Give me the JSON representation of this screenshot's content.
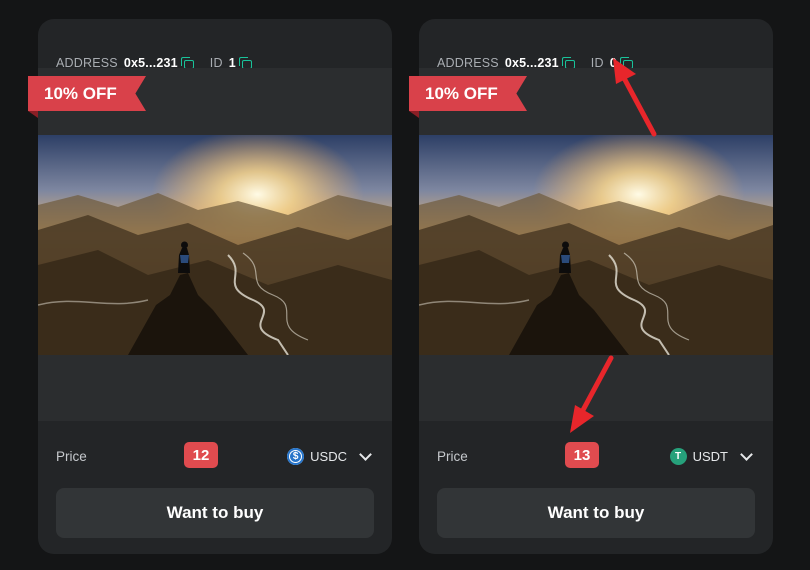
{
  "cards": [
    {
      "address_label": "ADDRESS",
      "address_value": "0x5...231",
      "id_label": "ID",
      "id_value": "1",
      "discount": "10% OFF",
      "price_label": "Price",
      "price_value": "12",
      "currency": "USDC",
      "buy_label": "Want to buy"
    },
    {
      "address_label": "ADDRESS",
      "address_value": "0x5...231",
      "id_label": "ID",
      "id_value": "0",
      "discount": "10% OFF",
      "price_label": "Price",
      "price_value": "13",
      "currency": "USDT",
      "buy_label": "Want to buy"
    }
  ],
  "colors": {
    "background": "#141516",
    "card": "#232527",
    "accent_red": "#e04b4f",
    "copy_icon": "#19c39a",
    "usdc": "#2775ca",
    "usdt": "#26a17b",
    "annotation_arrow": "#e8262b"
  },
  "icons": {
    "copy": "copy-icon",
    "usdc": "usdc-coin-icon",
    "usdt": "usdt-coin-icon",
    "dropdown": "chevron-down-icon"
  }
}
